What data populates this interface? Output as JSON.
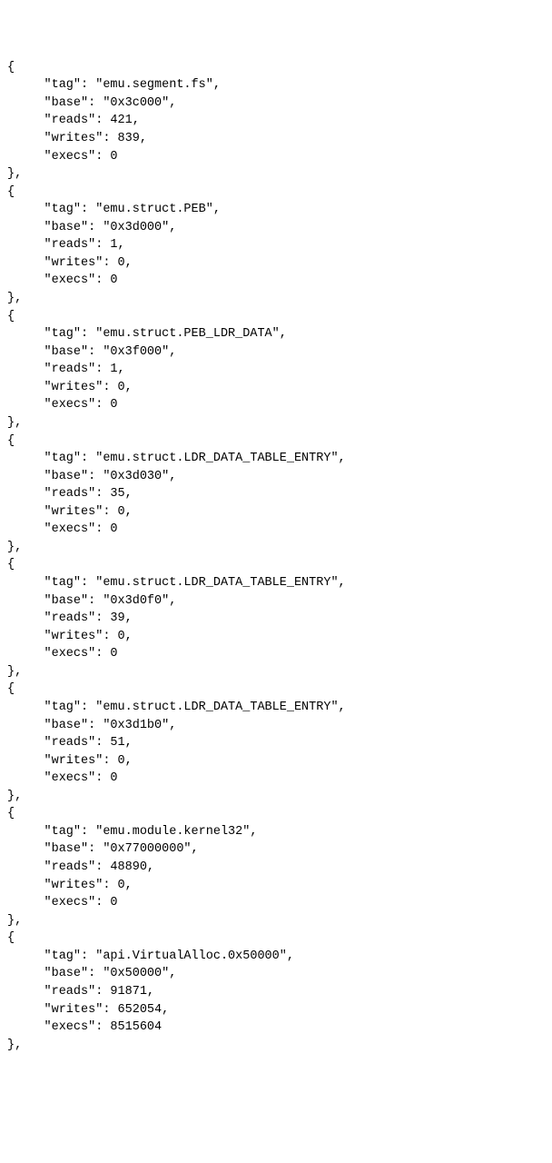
{
  "labels": {
    "tag": "\"tag\"",
    "base": "\"base\"",
    "reads": "\"reads\"",
    "writes": "\"writes\"",
    "execs": "\"execs\""
  },
  "entries": [
    {
      "tag": "\"emu.segment.fs\"",
      "base": "\"0x3c000\"",
      "reads": "421",
      "writes": "839",
      "execs": "0"
    },
    {
      "tag": "\"emu.struct.PEB\"",
      "base": "\"0x3d000\"",
      "reads": "1",
      "writes": "0",
      "execs": "0"
    },
    {
      "tag": "\"emu.struct.PEB_LDR_DATA\"",
      "base": "\"0x3f000\"",
      "reads": "1",
      "writes": "0",
      "execs": "0"
    },
    {
      "tag": "\"emu.struct.LDR_DATA_TABLE_ENTRY\"",
      "base": "\"0x3d030\"",
      "reads": "35",
      "writes": "0",
      "execs": "0"
    },
    {
      "tag": "\"emu.struct.LDR_DATA_TABLE_ENTRY\"",
      "base": "\"0x3d0f0\"",
      "reads": "39",
      "writes": "0",
      "execs": "0"
    },
    {
      "tag": "\"emu.struct.LDR_DATA_TABLE_ENTRY\"",
      "base": "\"0x3d1b0\"",
      "reads": "51",
      "writes": "0",
      "execs": "0"
    },
    {
      "tag": "\"emu.module.kernel32\"",
      "base": "\"0x77000000\"",
      "reads": "48890",
      "writes": "0",
      "execs": "0"
    },
    {
      "tag": "\"api.VirtualAlloc.0x50000\"",
      "base": "\"0x50000\"",
      "reads": "91871",
      "writes": "652054",
      "execs": "8515604"
    }
  ]
}
